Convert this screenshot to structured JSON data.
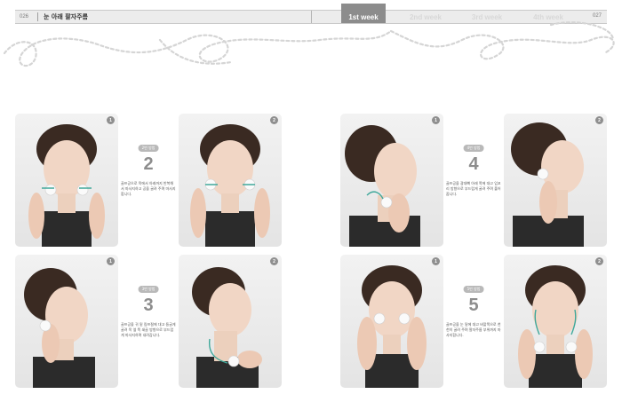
{
  "header": {
    "left_page": "026",
    "title": "눈 아래 팔자주름",
    "weeks": [
      {
        "label": "1st week",
        "active": true
      },
      {
        "label": "2nd week",
        "active": false
      },
      {
        "label": "3rd week",
        "active": false
      },
      {
        "label": "4th week",
        "active": false
      }
    ],
    "right_page": "027"
  },
  "steps": [
    {
      "badge": "2번 방법",
      "number": "2",
      "desc": "골프공으로 목에서 아래까지 반복해서 마사지하고 공을 굴려 주며 마사지합니다.",
      "photos": [
        "1",
        "2"
      ]
    },
    {
      "badge": "3번 방법",
      "number": "3",
      "desc": "골프공을 귀 밑 림프절에 대고 둥글게 굴려 목 옆 쪽 쇄골 방향으로 부드럽게 마사지하며 내려갑니다.",
      "photos": [
        "1",
        "2"
      ]
    },
    {
      "badge": "4번 방법",
      "number": "4",
      "desc": "골프공을 광대뼈 아래 쪽에 대고 입꼬리 방향으로 부드럽게 굴려 주며 풀어 줍니다.",
      "photos": [
        "1",
        "2"
      ]
    },
    {
      "badge": "5번 방법",
      "number": "5",
      "desc": "골프공을 눈 밑에 대고 바깥쪽으로 천천히 굴려 주며 팔자주름 부위까지 마사지합니다.",
      "photos": [
        "1",
        "2"
      ]
    }
  ],
  "colors": {
    "header_bg": "#ececec",
    "active_week": "#8c8c8c",
    "number_gray": "#8d8d8d",
    "wave": "#d5d5d5",
    "arrow": "#3fa89a"
  }
}
